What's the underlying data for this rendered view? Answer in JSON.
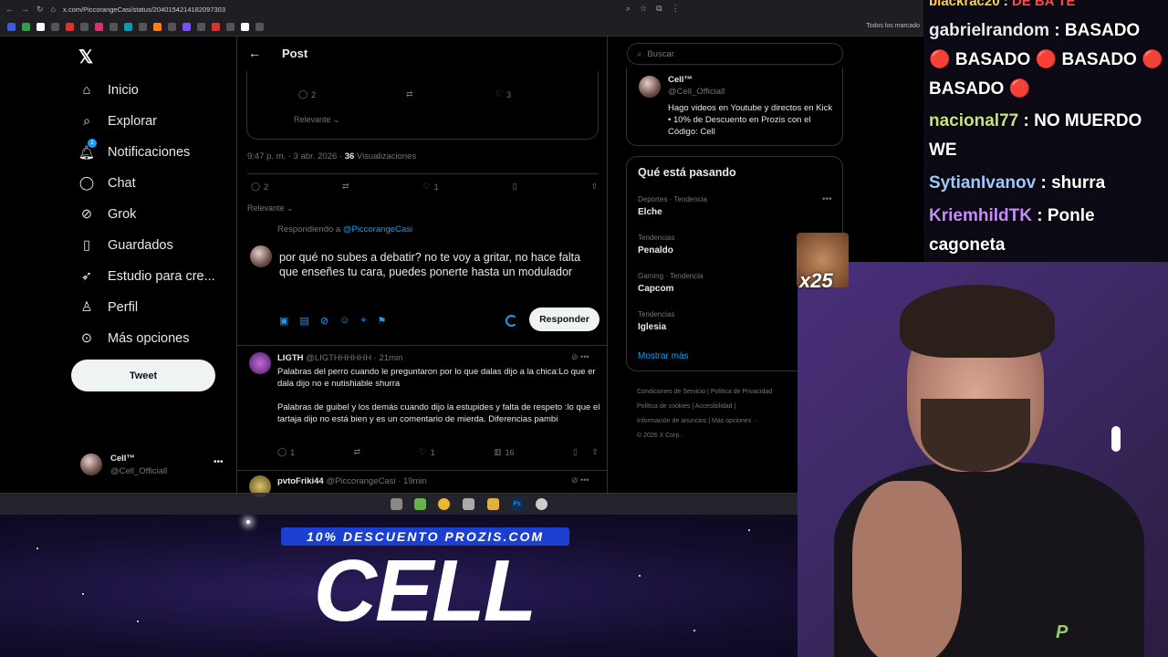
{
  "browser": {
    "url": "x.com/PiccorangeCasi/status/2040154214182097303",
    "bookmarks_all": "Todos los marcado"
  },
  "nav": {
    "items": [
      {
        "label": "Inicio"
      },
      {
        "label": "Explorar"
      },
      {
        "label": "Notificaciones",
        "badge": "1"
      },
      {
        "label": "Chat"
      },
      {
        "label": "Grok"
      },
      {
        "label": "Guardados"
      },
      {
        "label": "Estudio para cre..."
      },
      {
        "label": "Perfil"
      },
      {
        "label": "Más opciones"
      }
    ],
    "tweet_button": "Tweet"
  },
  "account": {
    "name": "Cell™",
    "handle": "@Cell_Officiall"
  },
  "post": {
    "title": "Post",
    "quote_replies": "2",
    "quote_likes": "3",
    "relevante": "Relevante",
    "time": "9:47 p. m. · 3 abr. 2026 ·",
    "views_count": "36",
    "views_label": "Visualizaciones",
    "replies": "2",
    "likes": "1"
  },
  "reply": {
    "replying_prefix": "Respondiendo a",
    "replying_handle": "@PiccorangeCasi",
    "text": "por qué no subes a debatir? no te voy a gritar, no hace falta que enseñes tu cara, puedes ponerte hasta un modulador",
    "button": "Responder"
  },
  "tweets": [
    {
      "name": "LIGTH",
      "handle": "@LIGTHHHHHH",
      "time": "21min",
      "body": "Palabras del perro cuando le preguntaron por lo que dalas  dijo a la chica:Lo que er dala dijo no e nutishiable shurra\n\nPalabras de guibel y los demás cuando  dijo la estupides y falta de respeto :lo que el tartaja dijo no está bien y es un comentario de mierda. Diferencias pambi",
      "replies": "1",
      "likes": "1",
      "views": "16"
    },
    {
      "name": "pvtoFriki44",
      "handle": "@PiccorangeCasi",
      "time": "19min"
    }
  ],
  "right": {
    "search_placeholder": "Buscar",
    "profile": {
      "name": "Cell™",
      "handle": "@Cell_Officiall",
      "bio": "Hago videos en Youtube y directos en Kick • 10% de Descuento en Prozis con el Código: Cell"
    },
    "trends_title": "Qué está pasando",
    "trends": [
      {
        "category": "Deportes · Tendencia",
        "name": "Elche"
      },
      {
        "category": "Tendencias",
        "name": "Penaldo"
      },
      {
        "category": "Gaming · Tendencia",
        "name": "Capcom"
      },
      {
        "category": "Tendencias",
        "name": "Iglesia"
      }
    ],
    "show_more": "Mostrar más",
    "footer": [
      "Condiciones de Servicio",
      "Política de Privacidad",
      "Política de cookies",
      "Accesibilidad",
      "Información de anuncios",
      "Más opciones ···",
      "© 2026 X Corp."
    ]
  },
  "chat": [
    {
      "user": "blackrac20",
      "msg": "DE BA TE"
    },
    {
      "user": "gabrielrandom",
      "msg": "BASADO 🔴 BASADO 🔴 BASADO 🔴 BASADO 🔴"
    },
    {
      "user": "nacional77",
      "msg": "NO MUERDO WE"
    },
    {
      "user": "SytianIvanov",
      "msg": "shurra"
    },
    {
      "user": "KriemhildTK",
      "msg": "Ponle cagoneta"
    }
  ],
  "overlay": {
    "emote_count": "x25",
    "promo": "10% DESCUENTO PROZIS.COM",
    "brand": "CELL"
  },
  "colors": {
    "accent": "#1d9bf0",
    "bg": "#000000",
    "muted": "#71767b"
  }
}
